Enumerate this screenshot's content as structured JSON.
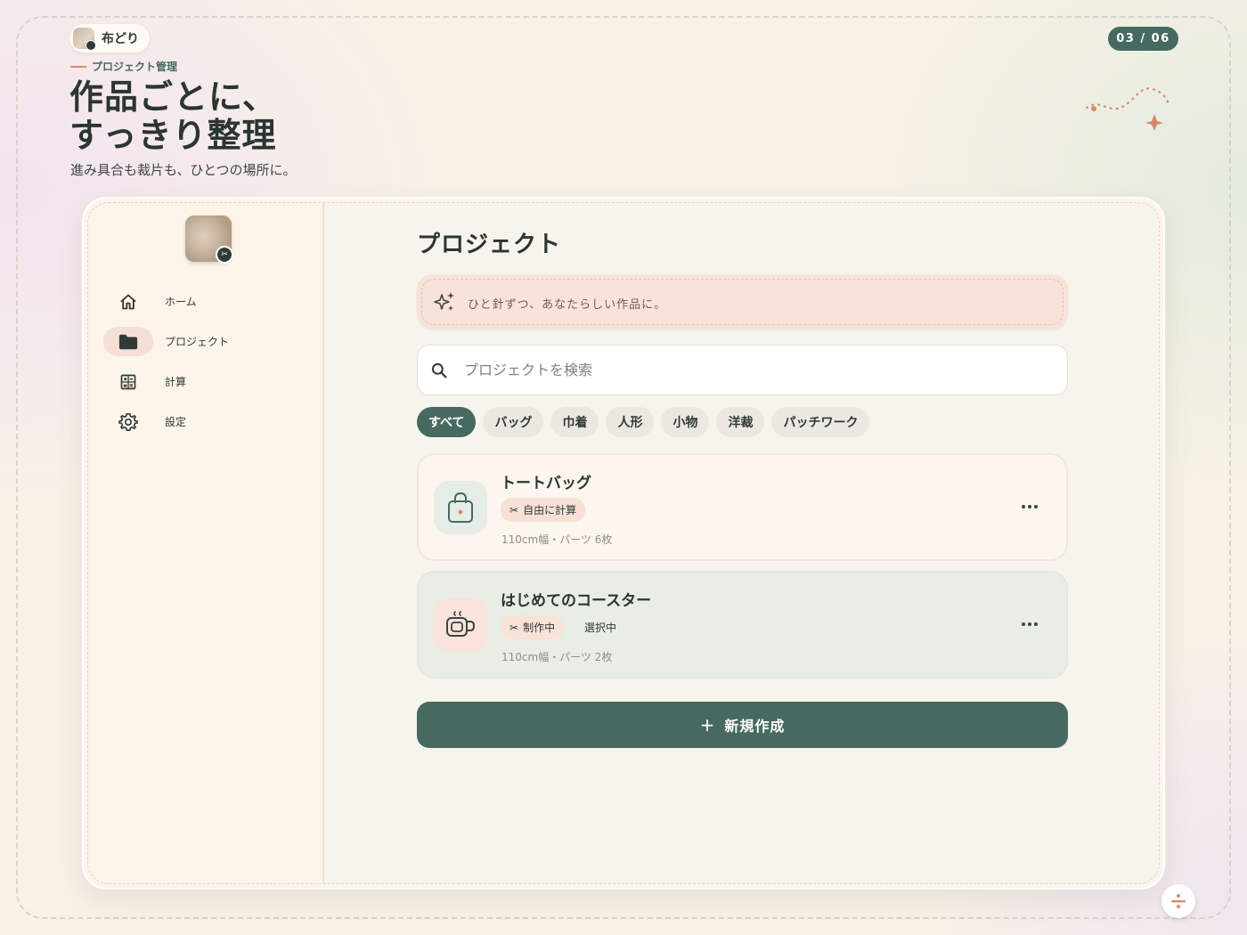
{
  "brand": {
    "name": "布どり"
  },
  "page_counter": "03 / 06",
  "hero": {
    "eyebrow": "プロジェクト管理",
    "headline_line1": "作品ごとに、",
    "headline_line2": "すっきり整理",
    "subhead": "進み具合も裁片も、ひとつの場所に。"
  },
  "sidebar": {
    "items": [
      {
        "label": "ホーム",
        "icon": "home-icon",
        "active": false
      },
      {
        "label": "プロジェクト",
        "icon": "folder-icon",
        "active": true
      },
      {
        "label": "計算",
        "icon": "calculator-icon",
        "active": false
      },
      {
        "label": "設定",
        "icon": "gear-icon",
        "active": false
      }
    ]
  },
  "main": {
    "title": "プロジェクト",
    "banner_text": "ひと針ずつ、あなたらしい作品に。",
    "search_placeholder": "プロジェクトを検索",
    "filters": [
      "すべて",
      "バッグ",
      "巾着",
      "人形",
      "小物",
      "洋裁",
      "パッチワーク"
    ],
    "active_filter": "すべて",
    "projects": [
      {
        "title": "トートバッグ",
        "tag": "自由に計算",
        "status": "",
        "meta": "110cm幅・パーツ 6枚",
        "icon": "bag-icon"
      },
      {
        "title": "はじめてのコースター",
        "tag": "制作中",
        "status": "選択中",
        "meta": "110cm幅・パーツ 2枚",
        "icon": "cup-icon"
      }
    ],
    "new_button": "新規作成",
    "new_button_icon": "+"
  },
  "colors": {
    "accent": "#466a60",
    "peach": "#f7e3d9",
    "orange": "#d58b6a"
  }
}
